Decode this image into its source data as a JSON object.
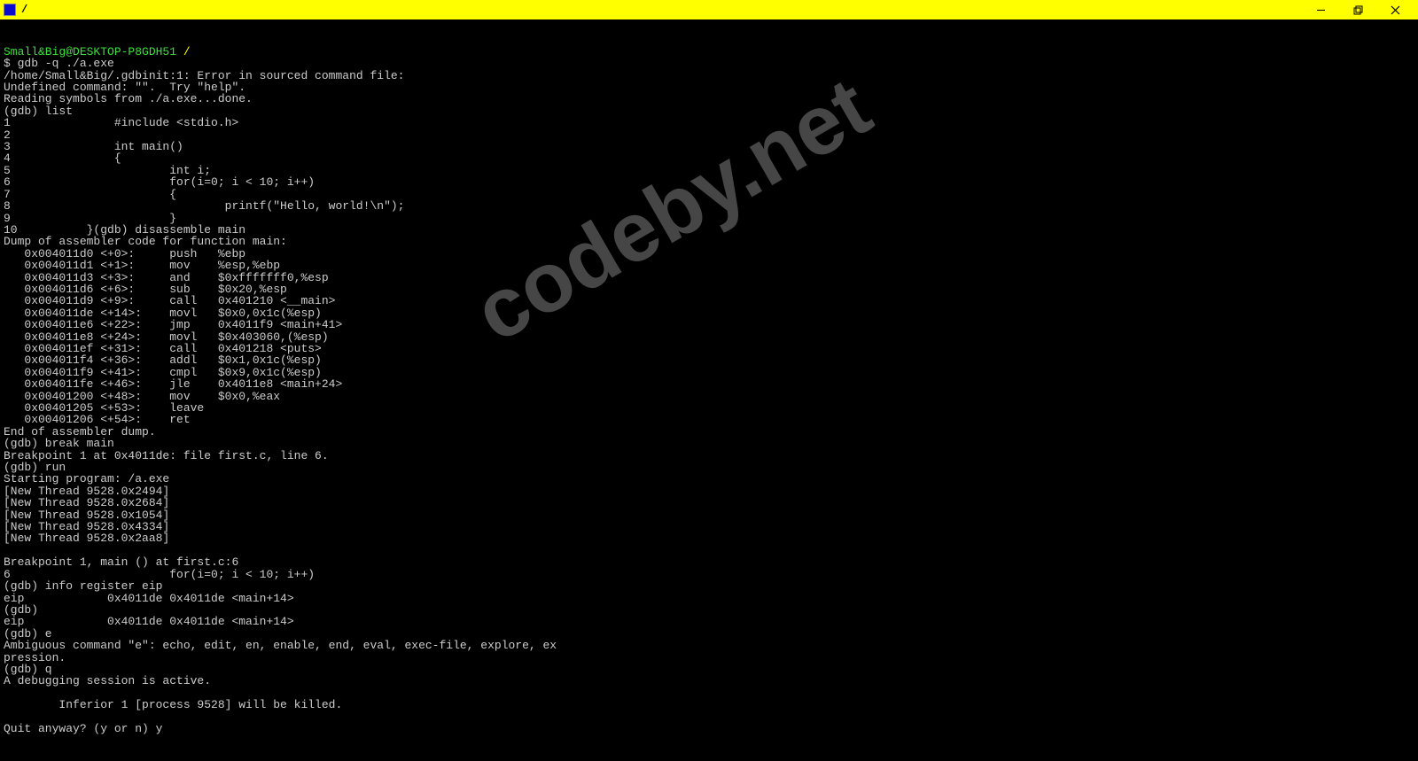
{
  "window": {
    "title": "/"
  },
  "prompt": {
    "user_host": "Small&Big@DESKTOP-P8GDH51",
    "cwd": "/"
  },
  "watermark": "codeby.net",
  "terminal_lines": [
    {
      "type": "cmd",
      "text": "$ gdb -q ./a.exe"
    },
    {
      "type": "out",
      "text": "/home/Small&Big/.gdbinit:1: Error in sourced command file:"
    },
    {
      "type": "out",
      "text": "Undefined command: \"\".  Try \"help\"."
    },
    {
      "type": "out",
      "text": "Reading symbols from ./a.exe...done."
    },
    {
      "type": "out",
      "text": "(gdb) list"
    },
    {
      "type": "out",
      "text": "1               #include <stdio.h>"
    },
    {
      "type": "out",
      "text": "2"
    },
    {
      "type": "out",
      "text": "3               int main()"
    },
    {
      "type": "out",
      "text": "4               {"
    },
    {
      "type": "out",
      "text": "5                       int i;"
    },
    {
      "type": "out",
      "text": "6                       for(i=0; i < 10; i++)"
    },
    {
      "type": "out",
      "text": "7                       {"
    },
    {
      "type": "out",
      "text": "8                               printf(\"Hello, world!\\n\");"
    },
    {
      "type": "out",
      "text": "9                       }"
    },
    {
      "type": "out",
      "text": "10          }(gdb) disassemble main"
    },
    {
      "type": "out",
      "text": "Dump of assembler code for function main:"
    },
    {
      "type": "out",
      "text": "   0x004011d0 <+0>:     push   %ebp"
    },
    {
      "type": "out",
      "text": "   0x004011d1 <+1>:     mov    %esp,%ebp"
    },
    {
      "type": "out",
      "text": "   0x004011d3 <+3>:     and    $0xfffffff0,%esp"
    },
    {
      "type": "out",
      "text": "   0x004011d6 <+6>:     sub    $0x20,%esp"
    },
    {
      "type": "out",
      "text": "   0x004011d9 <+9>:     call   0x401210 <__main>"
    },
    {
      "type": "out",
      "text": "   0x004011de <+14>:    movl   $0x0,0x1c(%esp)"
    },
    {
      "type": "out",
      "text": "   0x004011e6 <+22>:    jmp    0x4011f9 <main+41>"
    },
    {
      "type": "out",
      "text": "   0x004011e8 <+24>:    movl   $0x403060,(%esp)"
    },
    {
      "type": "out",
      "text": "   0x004011ef <+31>:    call   0x401218 <puts>"
    },
    {
      "type": "out",
      "text": "   0x004011f4 <+36>:    addl   $0x1,0x1c(%esp)"
    },
    {
      "type": "out",
      "text": "   0x004011f9 <+41>:    cmpl   $0x9,0x1c(%esp)"
    },
    {
      "type": "out",
      "text": "   0x004011fe <+46>:    jle    0x4011e8 <main+24>"
    },
    {
      "type": "out",
      "text": "   0x00401200 <+48>:    mov    $0x0,%eax"
    },
    {
      "type": "out",
      "text": "   0x00401205 <+53>:    leave"
    },
    {
      "type": "out",
      "text": "   0x00401206 <+54>:    ret"
    },
    {
      "type": "out",
      "text": "End of assembler dump."
    },
    {
      "type": "out",
      "text": "(gdb) break main"
    },
    {
      "type": "out",
      "text": "Breakpoint 1 at 0x4011de: file first.c, line 6."
    },
    {
      "type": "out",
      "text": "(gdb) run"
    },
    {
      "type": "out",
      "text": "Starting program: /a.exe"
    },
    {
      "type": "out",
      "text": "[New Thread 9528.0x2494]"
    },
    {
      "type": "out",
      "text": "[New Thread 9528.0x2684]"
    },
    {
      "type": "out",
      "text": "[New Thread 9528.0x1054]"
    },
    {
      "type": "out",
      "text": "[New Thread 9528.0x4334]"
    },
    {
      "type": "out",
      "text": "[New Thread 9528.0x2aa8]"
    },
    {
      "type": "out",
      "text": ""
    },
    {
      "type": "out",
      "text": "Breakpoint 1, main () at first.c:6"
    },
    {
      "type": "out",
      "text": "6                       for(i=0; i < 10; i++)"
    },
    {
      "type": "out",
      "text": "(gdb) info register eip"
    },
    {
      "type": "out",
      "text": "eip            0x4011de 0x4011de <main+14>"
    },
    {
      "type": "out",
      "text": "(gdb)"
    },
    {
      "type": "out",
      "text": "eip            0x4011de 0x4011de <main+14>"
    },
    {
      "type": "out",
      "text": "(gdb) e"
    },
    {
      "type": "out",
      "text": "Ambiguous command \"e\": echo, edit, en, enable, end, eval, exec-file, explore, ex"
    },
    {
      "type": "out",
      "text": "pression."
    },
    {
      "type": "out",
      "text": "(gdb) q"
    },
    {
      "type": "out",
      "text": "A debugging session is active."
    },
    {
      "type": "out",
      "text": ""
    },
    {
      "type": "out",
      "text": "        Inferior 1 [process 9528] will be killed."
    },
    {
      "type": "out",
      "text": ""
    },
    {
      "type": "out",
      "text": "Quit anyway? (y or n) y"
    }
  ]
}
